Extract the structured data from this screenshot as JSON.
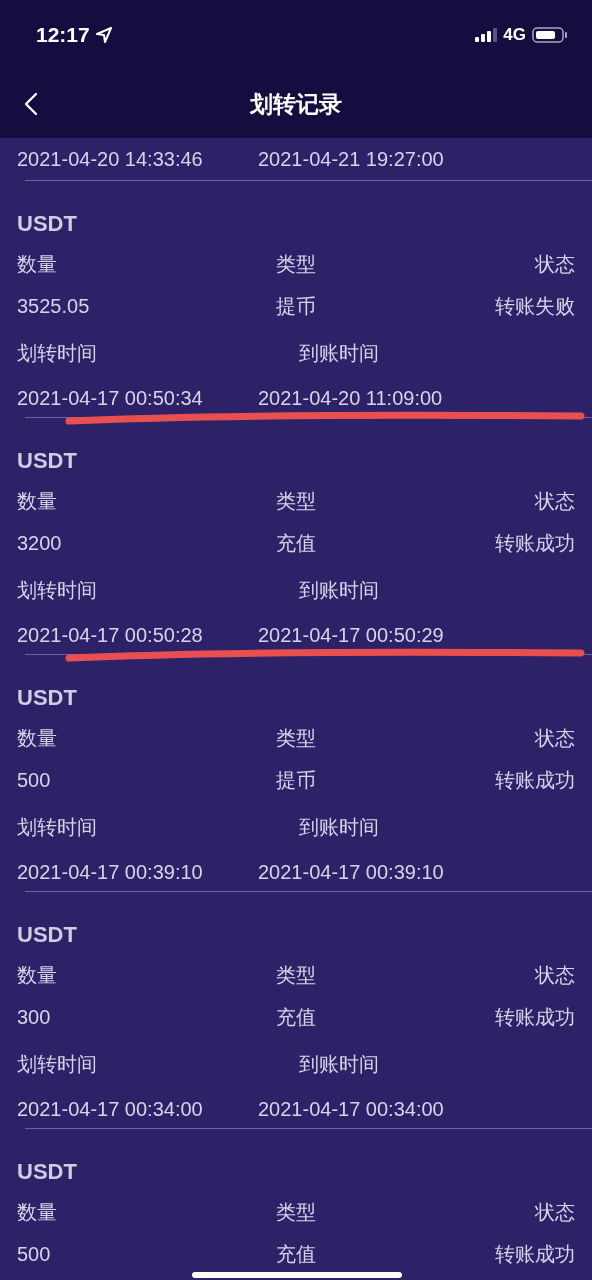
{
  "status_bar": {
    "time": "12:17",
    "network": "4G"
  },
  "nav": {
    "title": "划转记录"
  },
  "partial_record": {
    "transfer_time": "2021-04-20 14:33:46",
    "arrival_time": "2021-04-21 19:27:00"
  },
  "records": [
    {
      "coin": "USDT",
      "amount_label": "数量",
      "type_label": "类型",
      "status_label": "状态",
      "amount": "3525.05",
      "type": "提币",
      "status": "转账失败",
      "transfer_time_label": "划转时间",
      "arrival_time_label": "到账时间",
      "transfer_time": "2021-04-17 00:50:34",
      "arrival_time": "2021-04-20 11:09:00",
      "underlined": true
    },
    {
      "coin": "USDT",
      "amount_label": "数量",
      "type_label": "类型",
      "status_label": "状态",
      "amount": "3200",
      "type": "充值",
      "status": "转账成功",
      "transfer_time_label": "划转时间",
      "arrival_time_label": "到账时间",
      "transfer_time": "2021-04-17 00:50:28",
      "arrival_time": "2021-04-17 00:50:29",
      "underlined": true
    },
    {
      "coin": "USDT",
      "amount_label": "数量",
      "type_label": "类型",
      "status_label": "状态",
      "amount": "500",
      "type": "提币",
      "status": "转账成功",
      "transfer_time_label": "划转时间",
      "arrival_time_label": "到账时间",
      "transfer_time": "2021-04-17 00:39:10",
      "arrival_time": "2021-04-17 00:39:10"
    },
    {
      "coin": "USDT",
      "amount_label": "数量",
      "type_label": "类型",
      "status_label": "状态",
      "amount": "300",
      "type": "充值",
      "status": "转账成功",
      "transfer_time_label": "划转时间",
      "arrival_time_label": "到账时间",
      "transfer_time": "2021-04-17 00:34:00",
      "arrival_time": "2021-04-17 00:34:00"
    },
    {
      "coin": "USDT",
      "amount_label": "数量",
      "type_label": "类型",
      "status_label": "状态",
      "amount": "500",
      "type": "充值",
      "status": "转账成功"
    }
  ]
}
